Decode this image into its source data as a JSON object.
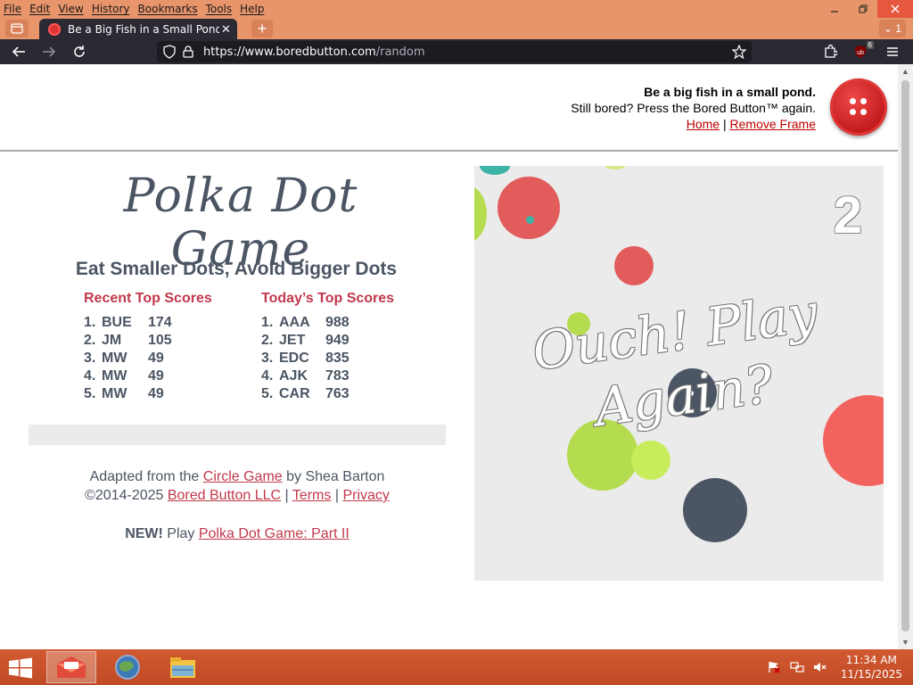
{
  "menubar": {
    "items": [
      "File",
      "Edit",
      "View",
      "History",
      "Bookmarks",
      "Tools",
      "Help"
    ]
  },
  "window": {
    "minimize_icon": "minimize-icon",
    "maximize_icon": "restore-icon",
    "close_icon": "close-icon"
  },
  "tabs": {
    "active_title": "Be a Big Fish in a Small Pond - Bored Button",
    "all_tabs_count": "1"
  },
  "navbar": {
    "url_host": "https://www.boredbutton.com",
    "url_path": "/random",
    "extension_badge": "6"
  },
  "frame_header": {
    "headline": "Be a big fish in a small pond.",
    "tagline": "Still bored? Press the Bored Button™ again.",
    "home_link": "Home",
    "separator": "|",
    "remove_frame_link": "Remove Frame"
  },
  "game": {
    "title": "Polka Dot Game",
    "subtitle": "Eat Smaller Dots, Avoid Bigger Dots",
    "recent_heading": "Recent Top Scores",
    "today_heading": "Today’s Top Scores",
    "recent_scores": [
      {
        "rank": "1.",
        "name": "BUE",
        "score": "174"
      },
      {
        "rank": "2.",
        "name": "JM",
        "score": "105"
      },
      {
        "rank": "3.",
        "name": "MW",
        "score": "49"
      },
      {
        "rank": "4.",
        "name": "MW",
        "score": "49"
      },
      {
        "rank": "5.",
        "name": "MW",
        "score": "49"
      }
    ],
    "today_scores": [
      {
        "rank": "1.",
        "name": "AAA",
        "score": "988"
      },
      {
        "rank": "2.",
        "name": "JET",
        "score": "949"
      },
      {
        "rank": "3.",
        "name": "EDC",
        "score": "835"
      },
      {
        "rank": "4.",
        "name": "AJK",
        "score": "783"
      },
      {
        "rank": "5.",
        "name": "CAR",
        "score": "763"
      }
    ],
    "current_score": "2",
    "message_line1": "Ouch! Play",
    "message_line2": "Again?"
  },
  "credits": {
    "adapted_prefix": "Adapted from the ",
    "circle_game_link": "Circle Game",
    "adapted_suffix": " by Shea Barton",
    "copyright_prefix": "©2014-2025 ",
    "bored_button_link": "Bored Button LLC",
    "sep1": " | ",
    "terms_link": "Terms",
    "sep2": " | ",
    "privacy_link": "Privacy",
    "new_label": "NEW!",
    "play_text": " Play ",
    "part2_link": "Polka Dot Game: Part II"
  },
  "taskbar": {
    "time": "11:34 AM",
    "date": "11/15/2025"
  },
  "colors": {
    "chrome_orange": "#e8956b",
    "dark_toolbar": "#2b2a33",
    "accent_red": "#c0394b",
    "slate_text": "#4b5563",
    "dot_red": "#e25c5c",
    "dot_green": "#b5dc4e",
    "dot_slate": "#4b5563",
    "dot_teal": "#3bb3a5"
  }
}
